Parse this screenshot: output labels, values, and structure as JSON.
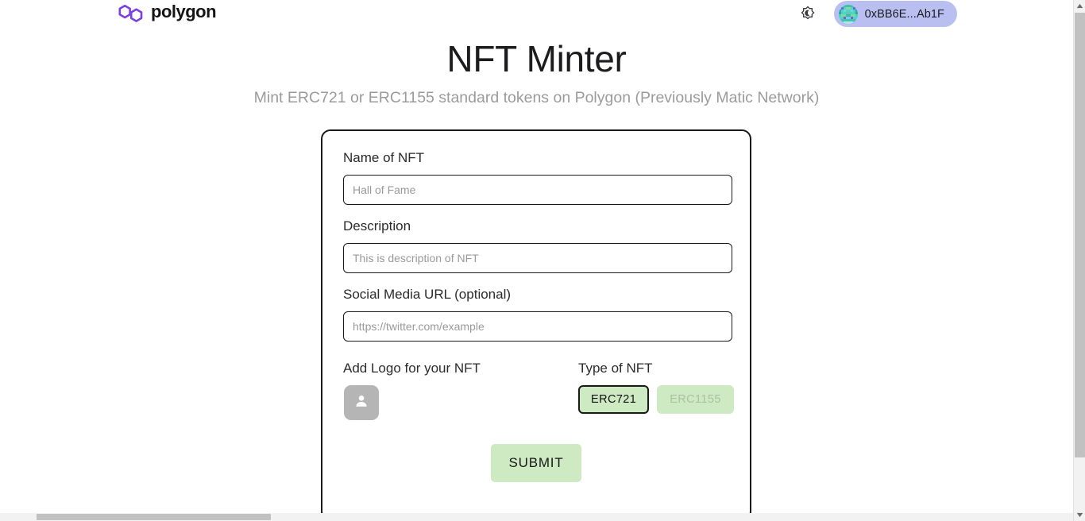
{
  "topbar": {
    "brand_name": "polygon",
    "brand_icon": "polygon-logo-icon",
    "theme_toggle_icon": "brightness-moon-sun-icon",
    "wallet_address": "0xBB6E...Ab1F",
    "wallet_avatar_icon": "blockie-identicon-avatar"
  },
  "header": {
    "title": "NFT Minter",
    "subtitle": "Mint ERC721 or ERC1155 standard tokens on Polygon (Previously Matic Network)"
  },
  "form": {
    "name_field": {
      "label": "Name of NFT",
      "placeholder": "Hall of Fame",
      "value": ""
    },
    "description_field": {
      "label": "Description",
      "placeholder": "This is description of NFT",
      "value": ""
    },
    "url_field": {
      "label": "Social Media URL (optional)",
      "placeholder": "https://twitter.com/example",
      "value": ""
    },
    "logo": {
      "label": "Add Logo for your NFT",
      "upload_icon": "person-placeholder-icon"
    },
    "type": {
      "label": "Type of NFT",
      "options": [
        {
          "label": "ERC721",
          "selected": true
        },
        {
          "label": "ERC1155",
          "selected": false
        }
      ]
    },
    "submit_label": "SUBMIT"
  },
  "colors": {
    "brand_purple": "#7b3fe4",
    "accent_green": "#cdeac3",
    "wallet_pill": "#b9bff0",
    "border_dark": "#1a1a1a",
    "subtitle_gray": "#9b9b9b"
  },
  "scrollbars": {
    "vertical_up_arrow": "▲",
    "vertical_down_arrow": "▼"
  }
}
